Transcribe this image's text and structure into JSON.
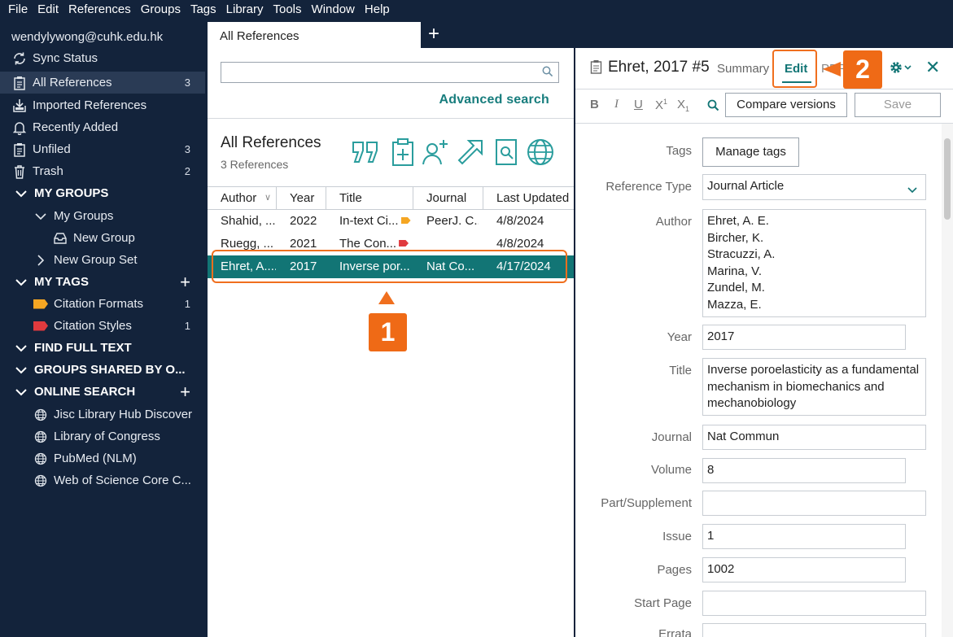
{
  "menubar": [
    "File",
    "Edit",
    "References",
    "Groups",
    "Tags",
    "Library",
    "Tools",
    "Window",
    "Help"
  ],
  "sidebar": {
    "account": "wendylywong@cuhk.edu.hk",
    "sync": "Sync Status",
    "items": [
      {
        "label": "All References",
        "count": "3",
        "icon": "clipboard-icon"
      },
      {
        "label": "Imported References",
        "count": "",
        "icon": "import-icon"
      },
      {
        "label": "Recently Added",
        "count": "",
        "icon": "bell-icon"
      },
      {
        "label": "Unfiled",
        "count": "3",
        "icon": "clipboard-icon"
      },
      {
        "label": "Trash",
        "count": "2",
        "icon": "trash-icon"
      }
    ],
    "my_groups_head": "MY GROUPS",
    "my_groups": "My Groups",
    "new_group": "New Group",
    "new_group_set": "New Group Set",
    "my_tags_head": "MY TAGS",
    "tags": [
      {
        "label": "Citation Formats",
        "count": "1",
        "color": "#f5a623"
      },
      {
        "label": "Citation Styles",
        "count": "1",
        "color": "#e03a3e"
      }
    ],
    "find_full_text": "FIND FULL TEXT",
    "groups_shared": "GROUPS SHARED BY O...",
    "online_search_head": "ONLINE SEARCH",
    "online": [
      "Jisc Library Hub Discover",
      "Library of Congress",
      "PubMed (NLM)",
      "Web of Science Core C..."
    ]
  },
  "tab": {
    "label": "All References"
  },
  "middle": {
    "advanced_search": "Advanced search",
    "title": "All References",
    "count": "3 References",
    "columns": [
      "Author",
      "Year",
      "Title",
      "Journal",
      "Last Updated"
    ],
    "rows": [
      {
        "author": "Shahid, ...",
        "year": "2022",
        "title": "In-text Ci...",
        "tag": "#f5a623",
        "journal": "PeerJ. C...",
        "updated": "4/8/2024"
      },
      {
        "author": "Ruegg, ...",
        "year": "2021",
        "title": "The Con...",
        "tag": "#e03a3e",
        "journal": "",
        "updated": "4/8/2024"
      },
      {
        "author": "Ehret, A....",
        "year": "2017",
        "title": "Inverse por...",
        "tag": "",
        "journal": "Nat Co...",
        "updated": "4/17/2024"
      }
    ]
  },
  "annotations": {
    "badge1": "1",
    "badge2": "2"
  },
  "detail": {
    "title": "Ehret, 2017 #5",
    "tab_summary": "Summary",
    "tab_edit": "Edit",
    "tab_pdf": "PDF",
    "compare": "Compare versions",
    "save": "Save",
    "labels": {
      "tags": "Tags",
      "ref_type": "Reference Type",
      "author": "Author",
      "year": "Year",
      "title": "Title",
      "journal": "Journal",
      "volume": "Volume",
      "part": "Part/Supplement",
      "issue": "Issue",
      "pages": "Pages",
      "start_page": "Start Page",
      "errata": "Errata"
    },
    "manage_tags": "Manage tags",
    "ref_type": "Journal Article",
    "authors": [
      "Ehret, A. E.",
      "Bircher, K.",
      "Stracuzzi, A.",
      "Marina, V.",
      "Zundel, M.",
      "Mazza, E."
    ],
    "year": "2017",
    "title_lines": [
      "Inverse poroelasticity as a fundamental",
      "mechanism in biomechanics and",
      "mechanobiology"
    ],
    "journal": "Nat Commun",
    "volume": "8",
    "part": "",
    "issue": "1",
    "pages": "1002",
    "start_page": ""
  }
}
